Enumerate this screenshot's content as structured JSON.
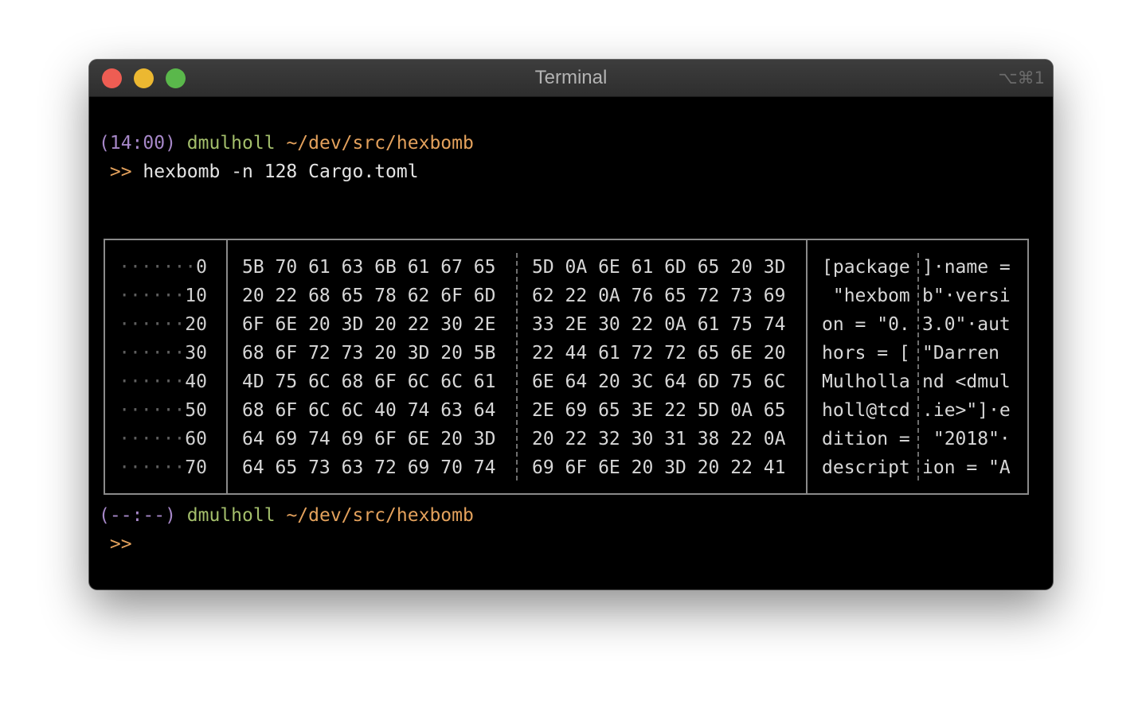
{
  "window": {
    "title": "Terminal",
    "shortcut": "⌥⌘1"
  },
  "prompt1": {
    "time": "(14:00)",
    "user": "dmulholl",
    "path": "~/dev/src/hexbomb",
    "arrow": ">>",
    "command": "hexbomb -n 128 Cargo.toml"
  },
  "hexdump": {
    "rows": [
      {
        "offset_dots": "·······",
        "offset": "0",
        "hex_left": "5B 70 61 63 6B 61 67 65",
        "hex_right": "5D 0A 6E 61 6D 65 20 3D",
        "ascii_left": "[package",
        "ascii_right": "]·name ="
      },
      {
        "offset_dots": "······",
        "offset": "10",
        "hex_left": "20 22 68 65 78 62 6F 6D",
        "hex_right": "62 22 0A 76 65 72 73 69",
        "ascii_left": " \"hexbom",
        "ascii_right": "b\"·versi"
      },
      {
        "offset_dots": "······",
        "offset": "20",
        "hex_left": "6F 6E 20 3D 20 22 30 2E",
        "hex_right": "33 2E 30 22 0A 61 75 74",
        "ascii_left": "on = \"0.",
        "ascii_right": "3.0\"·aut"
      },
      {
        "offset_dots": "······",
        "offset": "30",
        "hex_left": "68 6F 72 73 20 3D 20 5B",
        "hex_right": "22 44 61 72 72 65 6E 20",
        "ascii_left": "hors = [",
        "ascii_right": "\"Darren "
      },
      {
        "offset_dots": "······",
        "offset": "40",
        "hex_left": "4D 75 6C 68 6F 6C 6C 61",
        "hex_right": "6E 64 20 3C 64 6D 75 6C",
        "ascii_left": "Mulholla",
        "ascii_right": "nd <dmul"
      },
      {
        "offset_dots": "······",
        "offset": "50",
        "hex_left": "68 6F 6C 6C 40 74 63 64",
        "hex_right": "2E 69 65 3E 22 5D 0A 65",
        "ascii_left": "holl@tcd",
        "ascii_right": ".ie>\"]·e"
      },
      {
        "offset_dots": "······",
        "offset": "60",
        "hex_left": "64 69 74 69 6F 6E 20 3D",
        "hex_right": "20 22 32 30 31 38 22 0A",
        "ascii_left": "dition =",
        "ascii_right": " \"2018\"·"
      },
      {
        "offset_dots": "······",
        "offset": "70",
        "hex_left": "64 65 73 63 72 69 70 74",
        "hex_right": "69 6F 6E 20 3D 20 22 41",
        "ascii_left": "descript",
        "ascii_right": "ion = \"A"
      }
    ]
  },
  "prompt2": {
    "time": "(--:--)",
    "user": "dmulholl",
    "path": "~/dev/src/hexbomb",
    "arrow": ">>"
  },
  "colors": {
    "time": "#a687c8",
    "user": "#a3be6b",
    "path": "#e3a15c",
    "arrow": "#e3a15c",
    "background": "#000000",
    "border": "#8a8a8a"
  }
}
